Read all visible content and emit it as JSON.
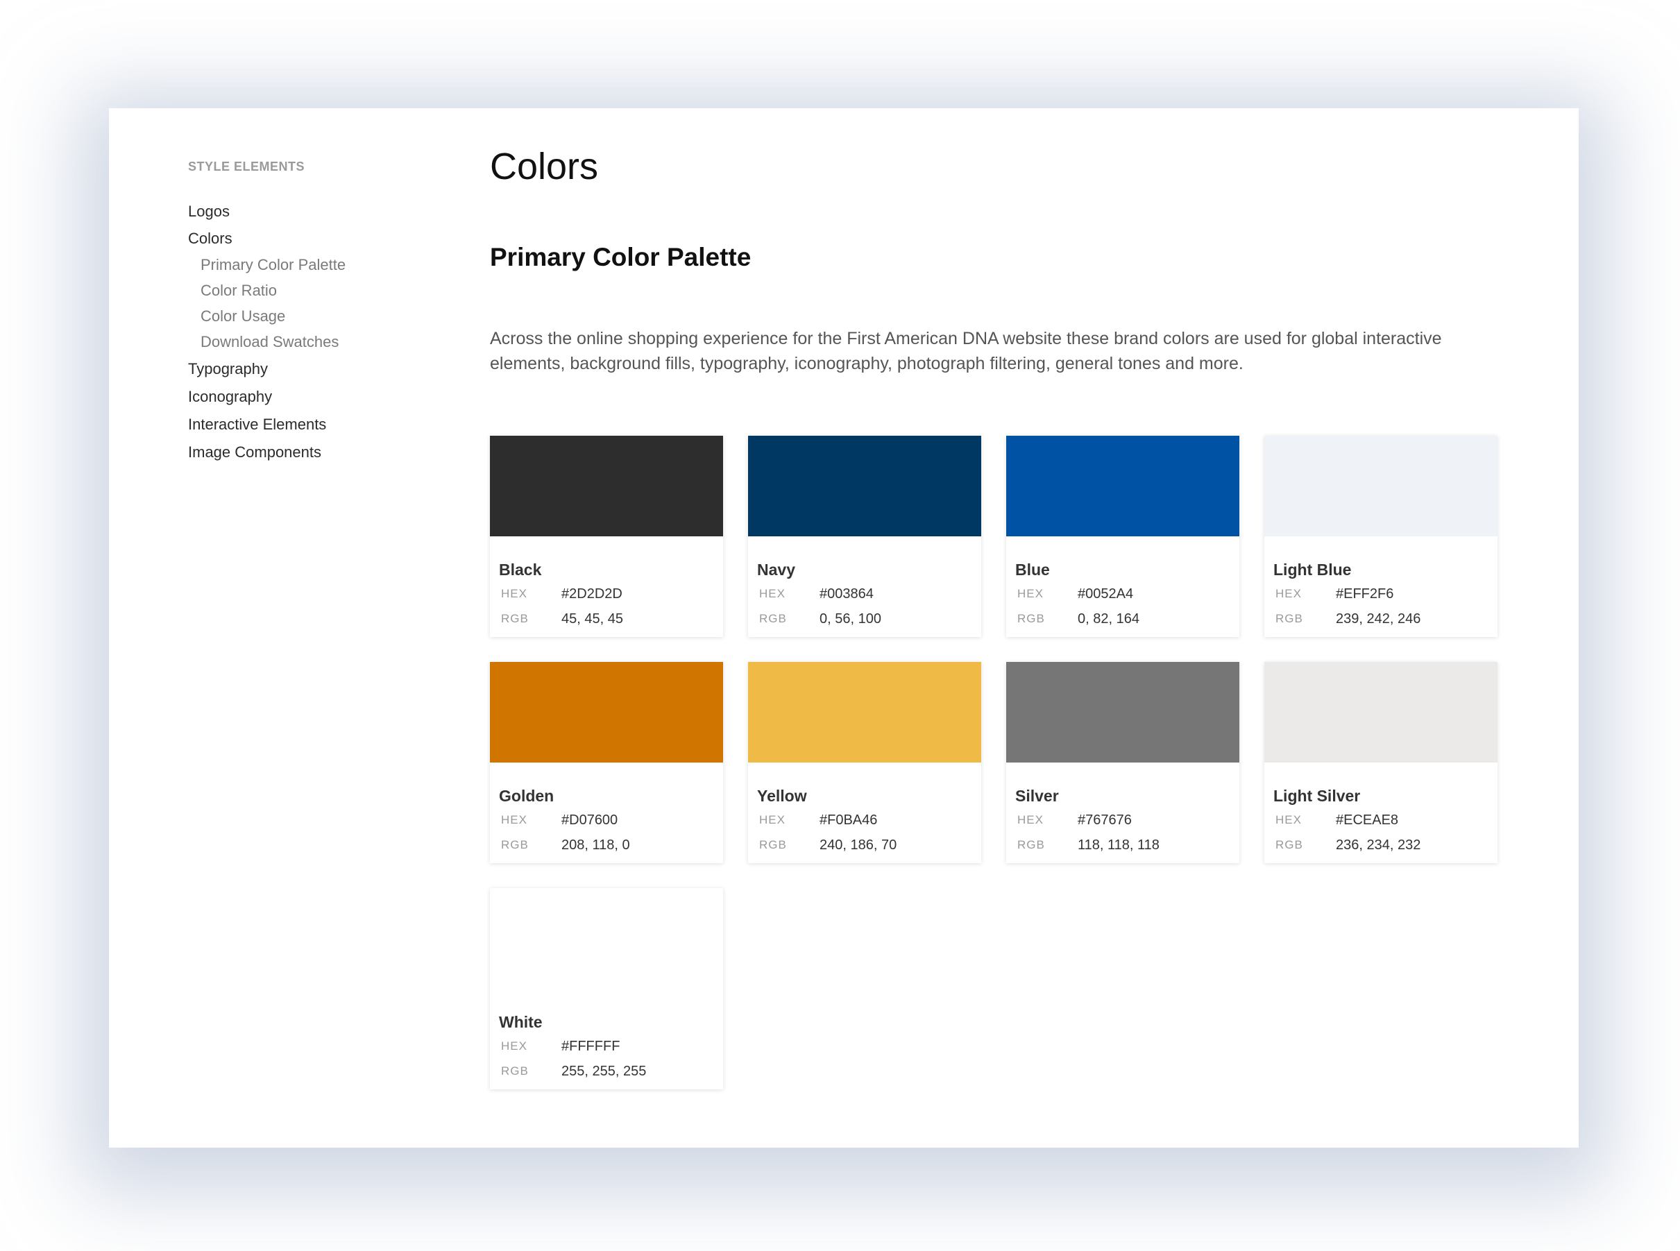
{
  "sidebar": {
    "section_label": "STYLE ELEMENTS",
    "items": [
      {
        "label": "Logos",
        "level": 1
      },
      {
        "label": "Colors",
        "level": 1
      },
      {
        "label": "Primary Color Palette",
        "level": 2
      },
      {
        "label": "Color Ratio",
        "level": 2
      },
      {
        "label": "Color Usage",
        "level": 2
      },
      {
        "label": "Download Swatches",
        "level": 2
      },
      {
        "label": "Typography",
        "level": 1
      },
      {
        "label": "Iconography",
        "level": 1
      },
      {
        "label": "Interactive Elements",
        "level": 1
      },
      {
        "label": "Image Components",
        "level": 1
      }
    ]
  },
  "main": {
    "title": "Colors",
    "section_title": "Primary Color Palette",
    "intro": "Across the online shopping experience for the First American DNA website these brand colors are used for global interactive elements, background fills, typography, iconography, photograph filtering, general tones and more.",
    "hex_label": "HEX",
    "rgb_label": "RGB",
    "swatches": [
      {
        "name": "Black",
        "hex": "#2D2D2D",
        "rgb": "45, 45, 45",
        "color": "#2D2D2D"
      },
      {
        "name": "Navy",
        "hex": "#003864",
        "rgb": "0, 56, 100",
        "color": "#003864"
      },
      {
        "name": "Blue",
        "hex": "#0052A4",
        "rgb": "0, 82, 164",
        "color": "#0052A4"
      },
      {
        "name": "Light Blue",
        "hex": "#EFF2F6",
        "rgb": "239, 242, 246",
        "color": "#EFF2F6"
      },
      {
        "name": "Golden",
        "hex": "#D07600",
        "rgb": "208, 118, 0",
        "color": "#D07600"
      },
      {
        "name": "Yellow",
        "hex": "#F0BA46",
        "rgb": "240, 186, 70",
        "color": "#F0BA46"
      },
      {
        "name": "Silver",
        "hex": "#767676",
        "rgb": "118, 118, 118",
        "color": "#767676"
      },
      {
        "name": "Light Silver",
        "hex": "#ECEAE8",
        "rgb": "236, 234, 232",
        "color": "#ECEAE8"
      },
      {
        "name": "White",
        "hex": "#FFFFFF",
        "rgb": "255, 255, 255",
        "color": "#FFFFFF"
      }
    ]
  }
}
